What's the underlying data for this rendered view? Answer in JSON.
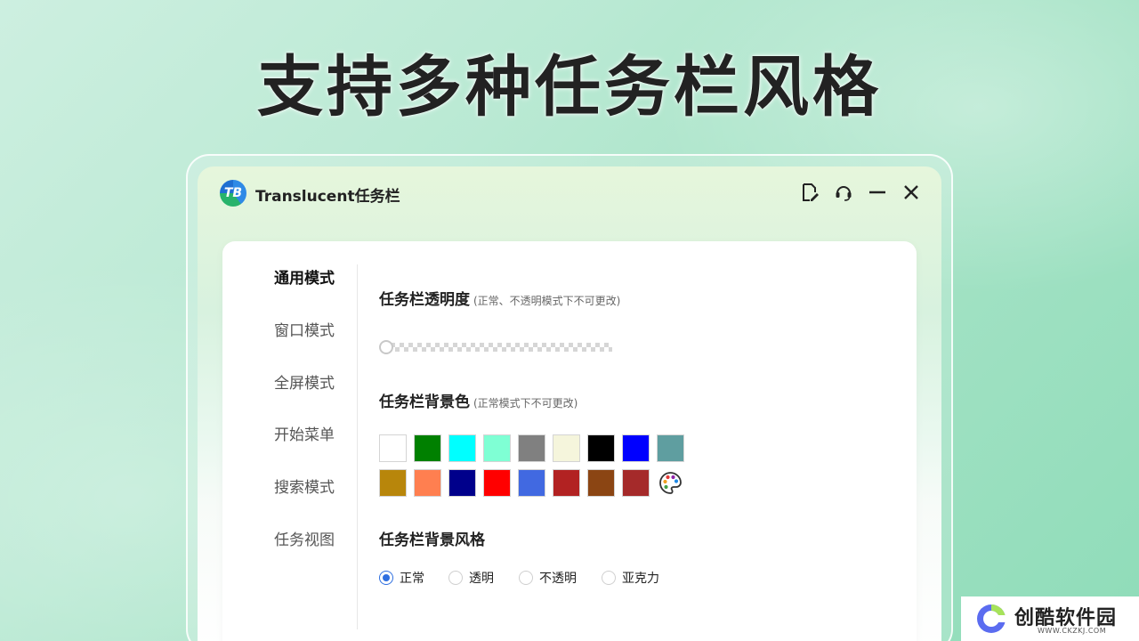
{
  "headline": "支持多种任务栏风格",
  "window": {
    "app_title": "Translucent任务栏",
    "logo_letters": "TB"
  },
  "titlebar_buttons": [
    {
      "name": "edit-note-icon"
    },
    {
      "name": "headset-icon"
    },
    {
      "name": "minimize-icon"
    },
    {
      "name": "close-icon"
    }
  ],
  "nav": {
    "items": [
      {
        "label": "通用模式",
        "active": true
      },
      {
        "label": "窗口模式",
        "active": false
      },
      {
        "label": "全屏模式",
        "active": false
      },
      {
        "label": "开始菜单",
        "active": false
      },
      {
        "label": "搜索模式",
        "active": false
      },
      {
        "label": "任务视图",
        "active": false
      }
    ]
  },
  "transparency": {
    "title": "任务栏透明度",
    "note": "(正常、不透明模式下不可更改)",
    "value": 0
  },
  "bg_color": {
    "title": "任务栏背景色",
    "note": "(正常模式下不可更改)",
    "swatches": [
      "#ffffff",
      "#008000",
      "#00ffff",
      "#7fffd4",
      "#808080",
      "#f5f5dc",
      "#000000",
      "#0000ff",
      "#5f9ea0",
      "#b8860b",
      "#ff7f50",
      "#00008b",
      "#ff0000",
      "#4169e1",
      "#b22222",
      "#8b4513",
      "#a52a2a"
    ],
    "palette_icon": "palette-icon"
  },
  "bg_style": {
    "title": "任务栏背景风格",
    "options": [
      {
        "label": "正常",
        "selected": true
      },
      {
        "label": "透明",
        "selected": false
      },
      {
        "label": "不透明",
        "selected": false
      },
      {
        "label": "亚克力",
        "selected": false
      }
    ]
  },
  "watermark": {
    "title": "创酷软件园",
    "url": "WWW.CKZKJ.COM"
  }
}
